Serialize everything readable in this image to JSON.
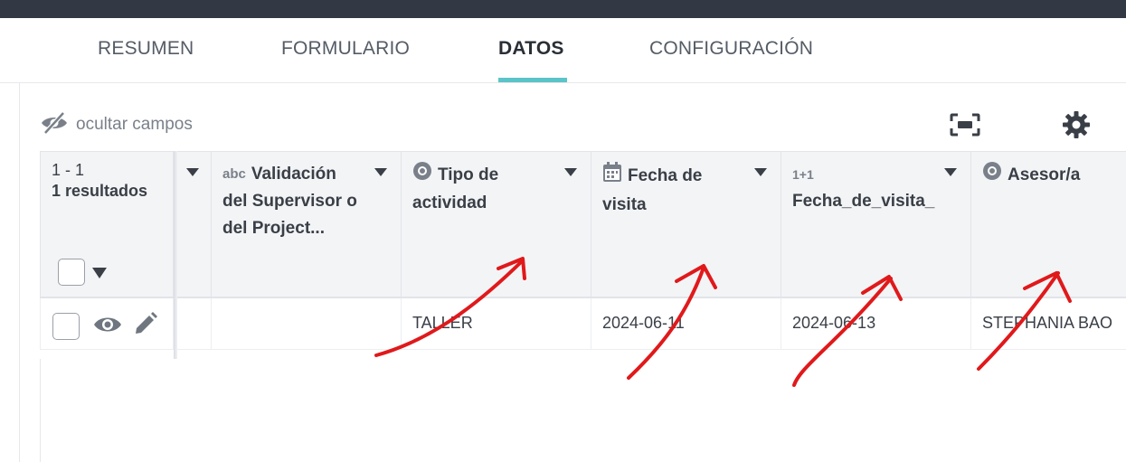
{
  "tabs": [
    {
      "label": "RESUMEN",
      "active": false
    },
    {
      "label": "FORMULARIO",
      "active": false
    },
    {
      "label": "DATOS",
      "active": true
    },
    {
      "label": "CONFIGURACIÓN",
      "active": false
    }
  ],
  "toolbar": {
    "hide_fields_label": "ocultar campos",
    "hide_fields_icon": "eye-slash-icon",
    "fullscreen_icon": "fullscreen-icon",
    "settings_icon": "gear-icon"
  },
  "table": {
    "range": "1 - 1",
    "results": "1 resultados",
    "columns": [
      {
        "type_icon": "abc-text-icon",
        "type_glyph": "abc",
        "label_line1": "Validación",
        "label_line2": "del Supervisor o",
        "label_line3": "del Project..."
      },
      {
        "type_icon": "radio-select-icon",
        "label_line1": "Tipo de",
        "label_line2": "actividad"
      },
      {
        "type_icon": "calendar-icon",
        "label_line1": "Fecha de",
        "label_line2": "visita"
      },
      {
        "type_icon": "calculate-icon",
        "type_glyph": "1+1",
        "label_line1": "",
        "label_line2": "Fecha_de_visita_"
      },
      {
        "type_icon": "radio-select-icon",
        "label_line1": "Asesor/a"
      }
    ],
    "rows": [
      {
        "cells": [
          "",
          "TALLER",
          "2024-06-11",
          "2024-06-13",
          "STEPHANIA BAO"
        ]
      }
    ]
  },
  "colors": {
    "topbar": "#323944",
    "accent": "#5bc4c8",
    "header_bg": "#f3f4f6",
    "annotation": "#e0191b"
  }
}
